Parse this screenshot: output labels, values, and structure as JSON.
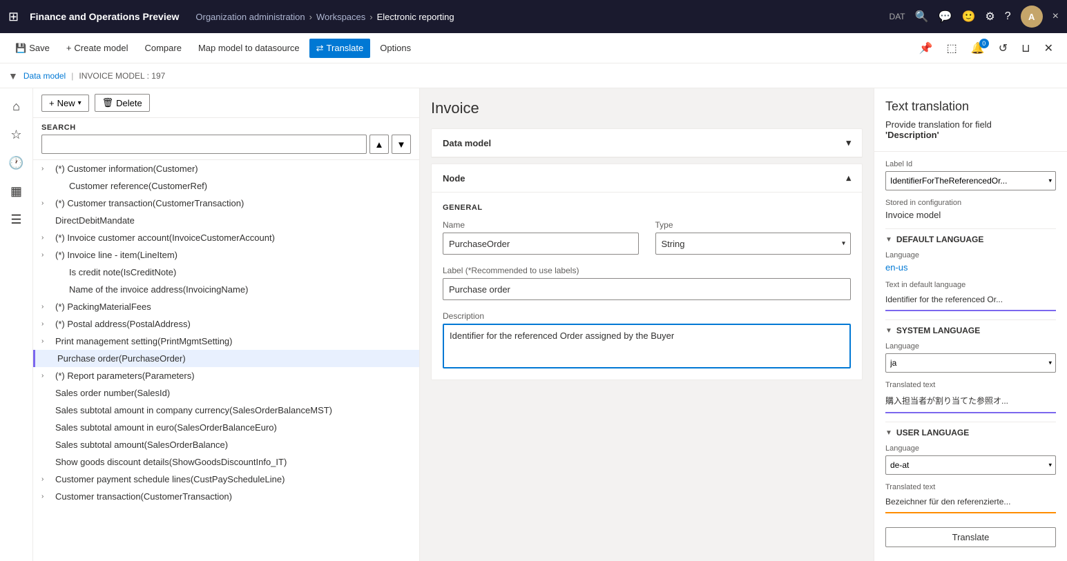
{
  "topNav": {
    "appTitle": "Finance and Operations Preview",
    "breadcrumbs": [
      "Organization administration",
      "Workspaces",
      "Electronic reporting"
    ],
    "envCode": "DAT",
    "closeLabel": "×"
  },
  "commandBar": {
    "saveLabel": "Save",
    "createModelLabel": "Create model",
    "compareLabel": "Compare",
    "mapModelLabel": "Map model to datasource",
    "translateLabel": "Translate",
    "optionsLabel": "Options"
  },
  "breadcrumbBar": {
    "dataModelLink": "Data model",
    "separator": "|",
    "invoiceModel": "INVOICE MODEL : 197"
  },
  "treePanel": {
    "newLabel": "New",
    "deleteLabel": "Delete",
    "searchLabel": "SEARCH",
    "searchPlaceholder": "",
    "items": [
      {
        "label": "(*) Customer information(Customer)",
        "indent": 0,
        "expandable": true
      },
      {
        "label": "Customer reference(CustomerRef)",
        "indent": 1,
        "expandable": false
      },
      {
        "label": "(*) Customer transaction(CustomerTransaction)",
        "indent": 0,
        "expandable": true
      },
      {
        "label": "DirectDebitMandate",
        "indent": 0,
        "expandable": false
      },
      {
        "label": "(*) Invoice customer account(InvoiceCustomerAccount)",
        "indent": 0,
        "expandable": true
      },
      {
        "label": "(*) Invoice line - item(LineItem)",
        "indent": 0,
        "expandable": true
      },
      {
        "label": "Is credit note(IsCreditNote)",
        "indent": 1,
        "expandable": false
      },
      {
        "label": "Name of the invoice address(InvoicingName)",
        "indent": 1,
        "expandable": false
      },
      {
        "label": "(*) PackingMaterialFees",
        "indent": 0,
        "expandable": true
      },
      {
        "label": "(*) Postal address(PostalAddress)",
        "indent": 0,
        "expandable": true
      },
      {
        "label": "Print management setting(PrintMgmtSetting)",
        "indent": 0,
        "expandable": true
      },
      {
        "label": "Purchase order(PurchaseOrder)",
        "indent": 0,
        "expandable": false,
        "selected": true
      },
      {
        "label": "(*) Report parameters(Parameters)",
        "indent": 0,
        "expandable": true
      },
      {
        "label": "Sales order number(SalesId)",
        "indent": 0,
        "expandable": false
      },
      {
        "label": "Sales subtotal amount in company currency(SalesOrderBalanceMST)",
        "indent": 0,
        "expandable": false
      },
      {
        "label": "Sales subtotal amount in euro(SalesOrderBalanceEuro)",
        "indent": 0,
        "expandable": false
      },
      {
        "label": "Sales subtotal amount(SalesOrderBalance)",
        "indent": 0,
        "expandable": false
      },
      {
        "label": "Show goods discount details(ShowGoodsDiscountInfo_IT)",
        "indent": 0,
        "expandable": false
      },
      {
        "label": "Customer payment schedule lines(CustPayScheduleLine)",
        "indent": 0,
        "expandable": true
      },
      {
        "label": "Customer transaction(CustomerTransaction)",
        "indent": 0,
        "expandable": true
      }
    ]
  },
  "mainContent": {
    "title": "Invoice",
    "dataModelSection": {
      "header": "Data model",
      "collapsed": false
    },
    "nodeSection": {
      "header": "Node",
      "generalLabel": "GENERAL",
      "nameLabel": "Name",
      "nameValue": "PurchaseOrder",
      "labelFieldLabel": "Label (*Recommended to use labels)",
      "labelFieldValue": "Purchase order",
      "descriptionLabel": "Description",
      "descriptionValue": "Identifier for the referenced Order assigned by the Buyer",
      "typeLabel": "Type",
      "typeValue": "String"
    }
  },
  "rightPanel": {
    "title": "Text translation",
    "subtitleLine1": "Provide translation for field",
    "subtitleLine2": "'Description'",
    "labelIdLabel": "Label Id",
    "labelIdValue": "IdentifierForTheReferencedOr...",
    "storedInConfigLabel": "Stored in configuration",
    "storedInConfigValue": "Invoice model",
    "sections": {
      "defaultLanguage": {
        "header": "DEFAULT LANGUAGE",
        "languageLabel": "Language",
        "languageValue": "en-us",
        "textLabel": "Text in default language",
        "textValue": "Identifier for the referenced Or..."
      },
      "systemLanguage": {
        "header": "SYSTEM LANGUAGE",
        "languageLabel": "Language",
        "languageValue": "ja",
        "translatedTextLabel": "Translated text",
        "translatedTextValue": "購入担当者が割り当てた参照オ..."
      },
      "userLanguage": {
        "header": "USER LANGUAGE",
        "languageLabel": "Language",
        "languageValue": "de-at",
        "translatedTextLabel": "Translated text",
        "translatedTextValue": "Bezeichner für den referenzierte..."
      }
    },
    "translateBtnLabel": "Translate"
  }
}
